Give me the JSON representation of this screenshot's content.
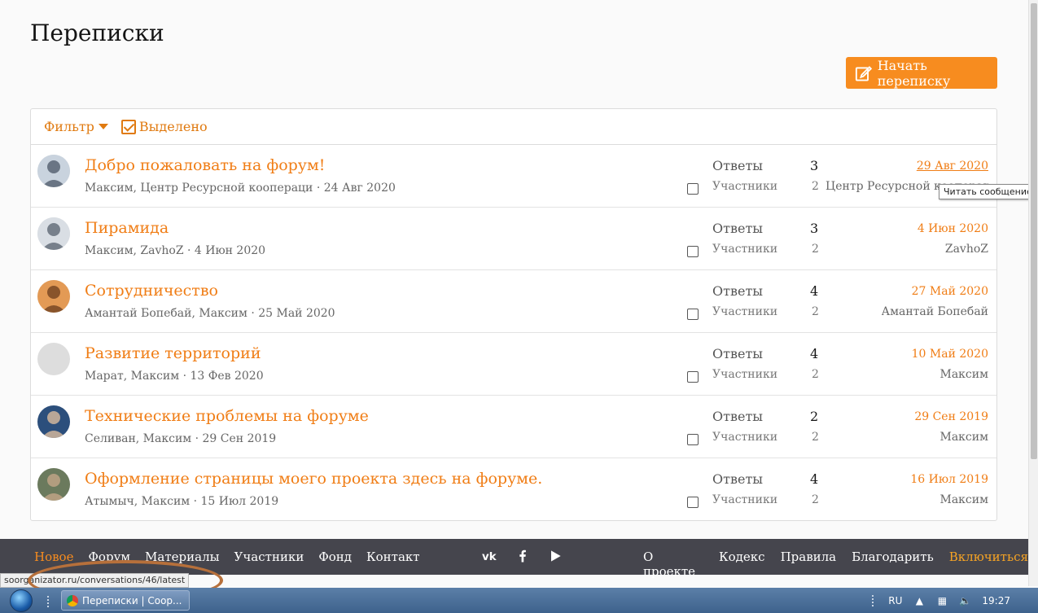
{
  "page": {
    "title": "Переписки"
  },
  "actions": {
    "start_conversation": "Начать переписку"
  },
  "filter_bar": {
    "filter_label": "Фильтр",
    "selected_label": "Выделено"
  },
  "labels": {
    "replies": "Ответы",
    "members": "Участники"
  },
  "conversations": [
    {
      "title": "Добро пожаловать на форум!",
      "meta": "Максим, Центр Ресурсной коопераци · 24 Авг 2020",
      "replies": "3",
      "members": "2",
      "last_date": "29 Авг 2020",
      "last_user": "Центр Ресурсной коопераци",
      "avatar": "photo"
    },
    {
      "title": "Пирамида",
      "meta": "Максим, ZavhoZ · 4 Июн 2020",
      "replies": "3",
      "members": "2",
      "last_date": "4 Июн 2020",
      "last_user": "ZavhoZ",
      "avatar": "photo"
    },
    {
      "title": "Сотрудничество",
      "meta": "Амантай Бопебай, Максим · 25 Май 2020",
      "replies": "4",
      "members": "2",
      "last_date": "27 Май 2020",
      "last_user": "Амантай Бопебай",
      "avatar": "photo"
    },
    {
      "title": "Развитие территорий",
      "meta": "Марат, Максим · 13 Фев 2020",
      "replies": "4",
      "members": "2",
      "last_date": "10 Май 2020",
      "last_user": "Максим",
      "avatar": "empty"
    },
    {
      "title": "Технические проблемы на форуме",
      "meta": "Селиван, Максим · 29 Сен 2019",
      "replies": "2",
      "members": "2",
      "last_date": "29 Сен 2019",
      "last_user": "Максим",
      "avatar": "photo"
    },
    {
      "title": "Оформление страницы моего проекта здесь на форуме.",
      "meta": "Атымыч, Максим · 15 Июл 2019",
      "replies": "4",
      "members": "2",
      "last_date": "16 Июл 2019",
      "last_user": "Максим",
      "avatar": "photo"
    }
  ],
  "tooltip": "Читать сообщение",
  "footer": {
    "left_links": [
      "Новое",
      "Форум",
      "Материалы",
      "Участники",
      "Фонд",
      "Контакт"
    ],
    "social_icons": [
      "vk-icon",
      "facebook-icon",
      "youtube-icon"
    ],
    "right_links": [
      "О проекте",
      "Кодекс",
      "Правила",
      "Благодарить"
    ],
    "cta": "Включиться"
  },
  "status_url": "soorganizator.ru/conversations/46/latest",
  "taskbar": {
    "task_title": "Переписки | Соор...",
    "lang": "RU",
    "time": "19:27"
  },
  "colors": {
    "accent": "#f78c1f",
    "link": "#f07d15",
    "footer_bg": "#45454d"
  }
}
